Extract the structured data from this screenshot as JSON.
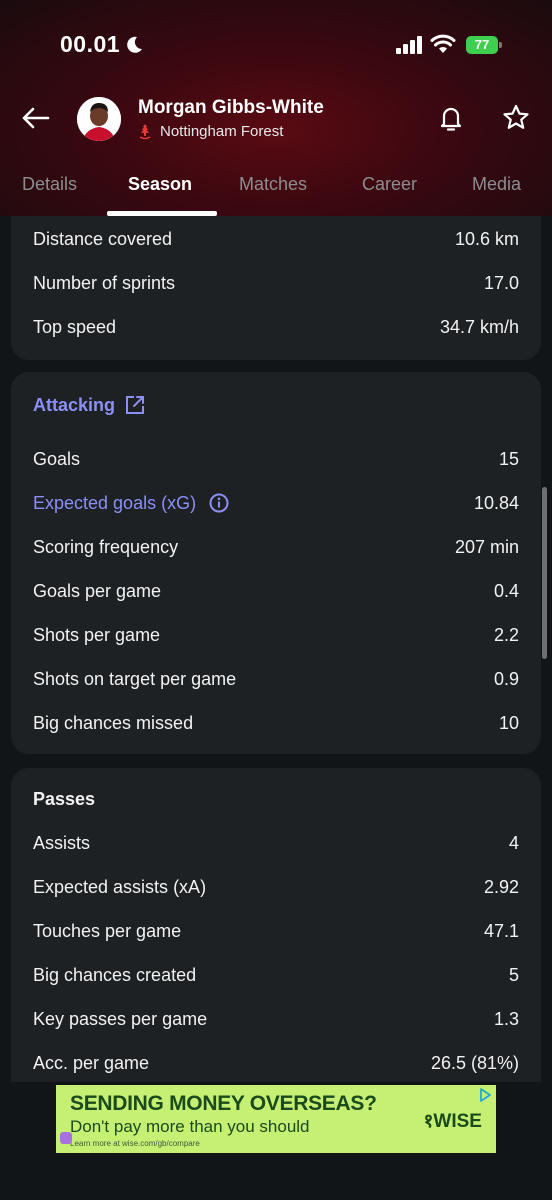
{
  "status_bar": {
    "time": "00.01",
    "battery": "77"
  },
  "header": {
    "player_name": "Morgan Gibbs-White",
    "team_name": "Nottingham Forest"
  },
  "tabs": [
    {
      "label": "Details"
    },
    {
      "label": "Season"
    },
    {
      "label": "Matches"
    },
    {
      "label": "Career"
    },
    {
      "label": "Media"
    }
  ],
  "active_tab": "Season",
  "physical": {
    "rows": [
      {
        "label": "Distance covered",
        "value": "10.6 km"
      },
      {
        "label": "Number of sprints",
        "value": "17.0"
      },
      {
        "label": "Top speed",
        "value": "34.7 km/h"
      }
    ]
  },
  "attacking": {
    "title": "Attacking",
    "rows": [
      {
        "label": "Goals",
        "value": "15"
      },
      {
        "label": "Expected goals (xG)",
        "value": "10.84"
      },
      {
        "label": "Scoring frequency",
        "value": "207 min"
      },
      {
        "label": "Goals per game",
        "value": "0.4"
      },
      {
        "label": "Shots per game",
        "value": "2.2"
      },
      {
        "label": "Shots on target per game",
        "value": "0.9"
      },
      {
        "label": "Big chances missed",
        "value": "10"
      }
    ]
  },
  "passes": {
    "title": "Passes",
    "rows": [
      {
        "label": "Assists",
        "value": "4"
      },
      {
        "label": "Expected assists (xA)",
        "value": "2.92"
      },
      {
        "label": "Touches per game",
        "value": "47.1"
      },
      {
        "label": "Big chances created",
        "value": "5"
      },
      {
        "label": "Key passes per game",
        "value": "1.3"
      },
      {
        "label": "Acc. per game",
        "value": "26.5 (81%)"
      }
    ]
  },
  "ad": {
    "headline": "SENDING MONEY OVERSEAS?",
    "subline": "Don't pay more than you should",
    "footer": "Learn more at wise.com/gb/compare",
    "brand": "१WISE"
  },
  "colors": {
    "accent": "#8c8ff5",
    "card": "#1d2124",
    "background": "#121517",
    "header": "#3a0810",
    "ad_background": "#c5f074",
    "ad_text": "#1b4a1b"
  },
  "icons": {
    "status": [
      "moon-icon",
      "signal-icon",
      "wifi-icon",
      "battery-icon"
    ],
    "header": [
      "back-arrow-icon",
      "bell-icon",
      "star-icon",
      "team-crest-icon"
    ],
    "attacking_title": "external-link-icon",
    "xg_label": "info-icon"
  }
}
